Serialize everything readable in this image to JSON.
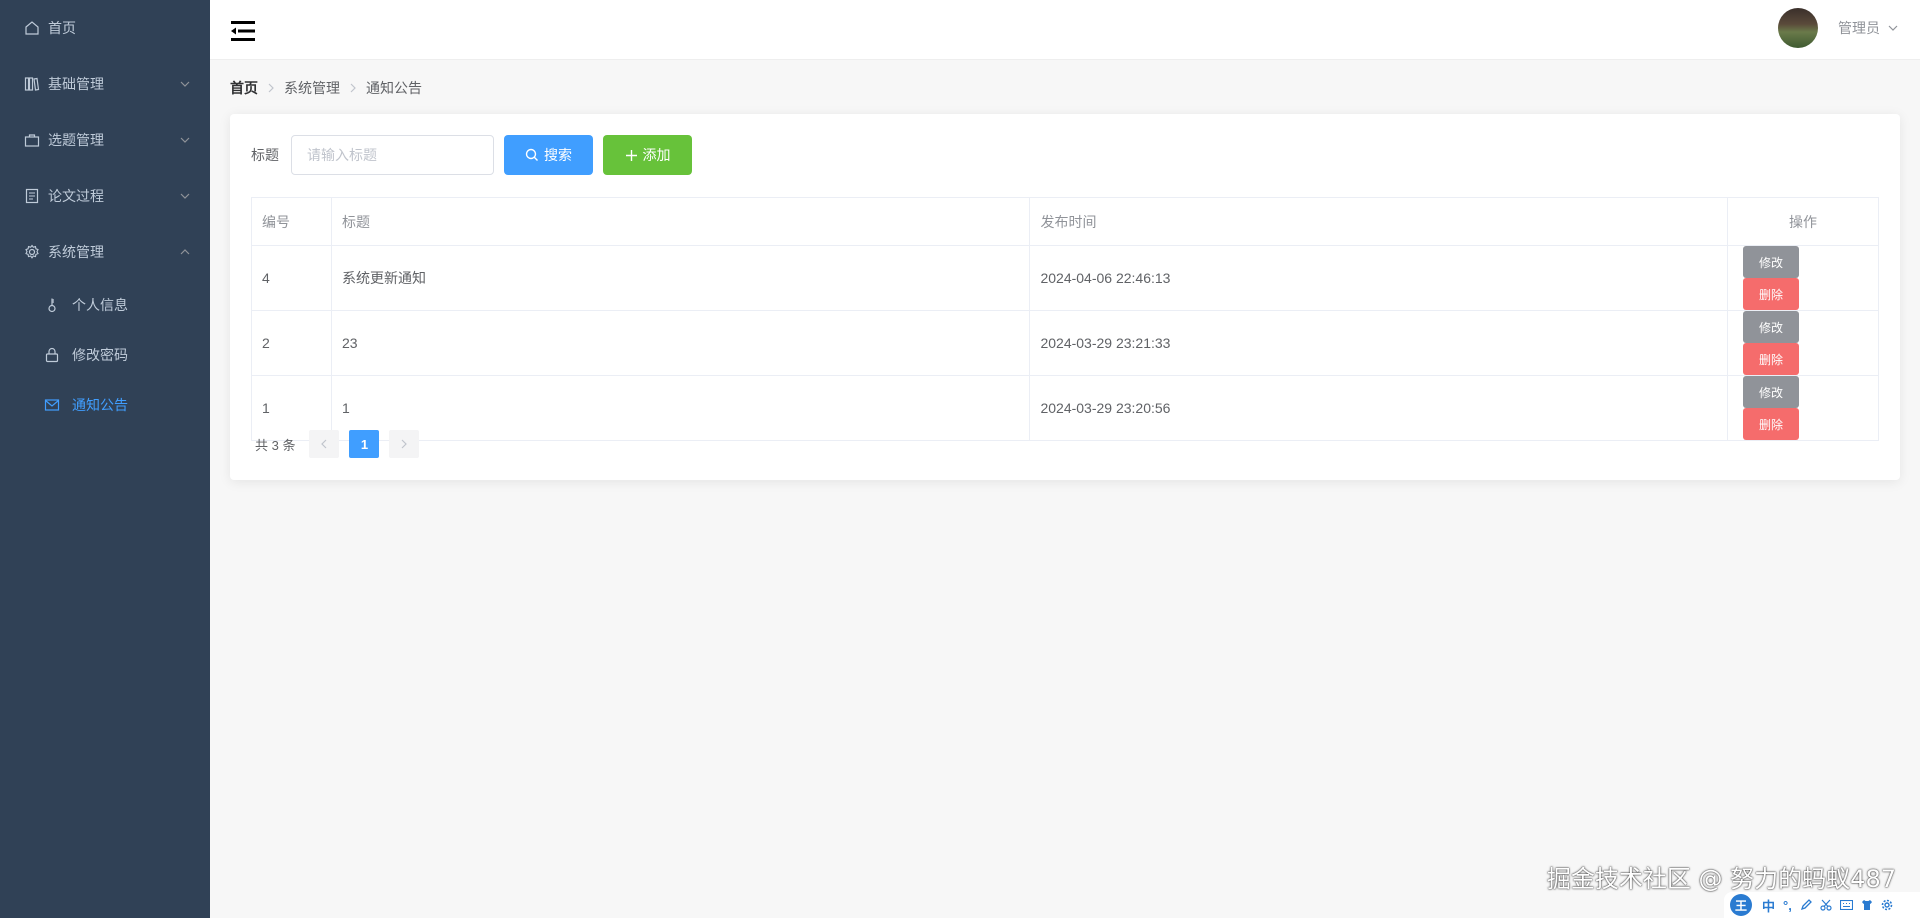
{
  "sidebar": {
    "items": [
      {
        "label": "首页",
        "icon": "home-icon",
        "has_arrow": false
      },
      {
        "label": "基础管理",
        "icon": "library-icon",
        "has_arrow": true
      },
      {
        "label": "选题管理",
        "icon": "briefcase-icon",
        "has_arrow": true
      },
      {
        "label": "论文过程",
        "icon": "document-icon",
        "has_arrow": true
      },
      {
        "label": "系统管理",
        "icon": "gear-icon",
        "has_arrow": true,
        "expanded": true
      }
    ],
    "sub_items": [
      {
        "label": "个人信息",
        "icon": "key-icon"
      },
      {
        "label": "修改密码",
        "icon": "lock-icon"
      },
      {
        "label": "通知公告",
        "icon": "message-icon",
        "active": true
      }
    ]
  },
  "header": {
    "user_name": "管理员"
  },
  "breadcrumb": [
    "首页",
    "系统管理",
    "通知公告"
  ],
  "toolbar": {
    "title_label": "标题",
    "search_placeholder": "请输入标题",
    "search_label": "搜索",
    "add_label": "添加"
  },
  "table": {
    "headers": [
      "编号",
      "标题",
      "发布时间",
      "操作"
    ],
    "rows": [
      {
        "id": "4",
        "title": "系统更新通知",
        "time": "2024-04-06 22:46:13"
      },
      {
        "id": "2",
        "title": "23",
        "time": "2024-03-29 23:21:33"
      },
      {
        "id": "1",
        "title": "1",
        "time": "2024-03-29 23:20:56"
      }
    ],
    "edit_label": "修改",
    "delete_label": "删除"
  },
  "pagination": {
    "total_text": "共 3 条",
    "current_page": "1"
  },
  "watermark": "掘金技术社区 @ 努力的蚂蚁487",
  "ime": {
    "logo": "王",
    "mode": "中",
    "colors": {
      "accent": "#2a7bd1"
    }
  },
  "colors": {
    "sidebar_bg": "#304156",
    "primary": "#409eff",
    "success": "#67c23a",
    "danger": "#f56c6c",
    "info": "#909399"
  }
}
